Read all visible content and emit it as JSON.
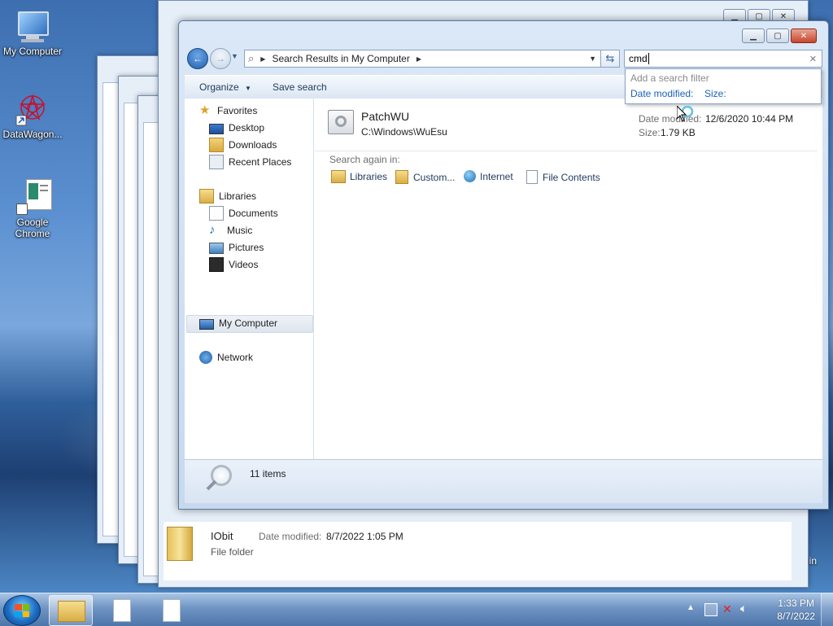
{
  "desktop": {
    "icons": [
      {
        "label": "My Computer",
        "icon": "computer-icon"
      },
      {
        "label": "DataWagon...",
        "icon": "datawagon-icon"
      },
      {
        "label": "Google Chrome",
        "icon": "chrome-shortcut-icon"
      }
    ],
    "recycle_label": "rcle Bin"
  },
  "bg_window": {
    "file": {
      "name": "IObit",
      "type": "File folder",
      "date_label": "Date modified:",
      "date_value": "8/7/2022 1:05 PM"
    }
  },
  "explorer": {
    "address": {
      "location": "Search Results in My Computer"
    },
    "search": {
      "value": "cmd"
    },
    "search_popup": {
      "hint": "Add a search filter",
      "filter_date": "Date modified:",
      "filter_size": "Size:"
    },
    "toolbar": {
      "organize": "Organize",
      "save_search": "Save search"
    },
    "nav": {
      "favorites": "Favorites",
      "desktop": "Desktop",
      "downloads": "Downloads",
      "recent": "Recent Places",
      "libraries": "Libraries",
      "documents": "Documents",
      "music": "Music",
      "pictures": "Pictures",
      "videos": "Videos",
      "my_computer": "My Computer",
      "network": "Network"
    },
    "result": {
      "name": "PatchWU",
      "path": "C:\\Windows\\WuEsu",
      "date_label": "Date modified:",
      "date_value": "12/6/2020 10:44 PM",
      "size_label": "Size:",
      "size_value": "1.79 KB"
    },
    "search_again": {
      "label": "Search again in:",
      "libraries": "Libraries",
      "custom": "Custom...",
      "internet": "Internet",
      "file_contents": "File Contents"
    },
    "status": {
      "count": "11 items"
    }
  },
  "taskbar": {
    "clock_time": "1:33 PM",
    "clock_date": "8/7/2022"
  }
}
